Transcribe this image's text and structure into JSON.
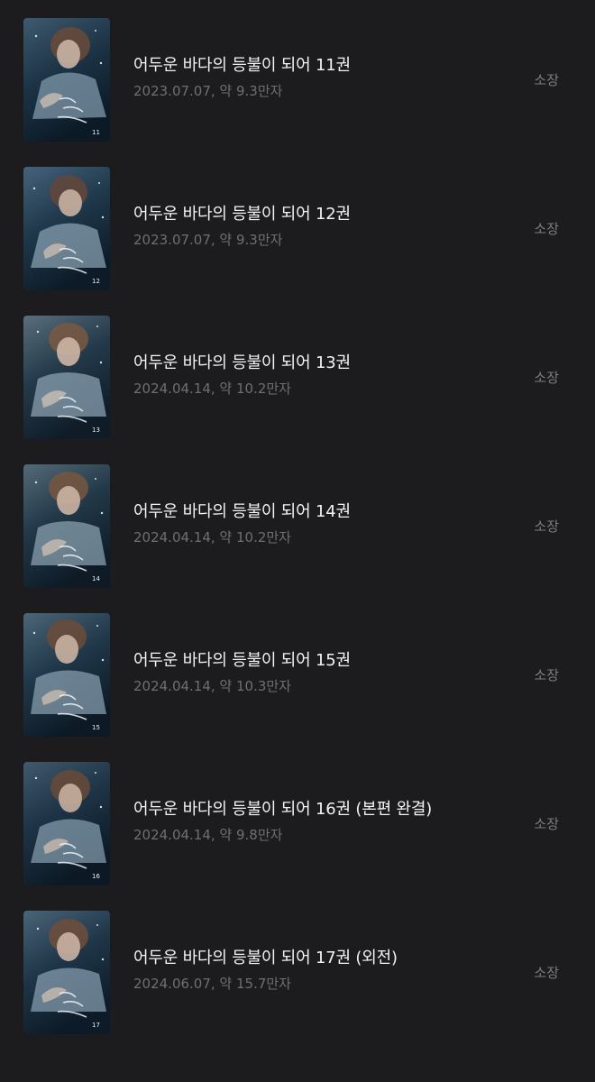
{
  "books": [
    {
      "title": "어두운 바다의 등불이 되어 11권",
      "meta": "2023.07.07, 약 9.3만자",
      "status": "소장",
      "cover_number": "11"
    },
    {
      "title": "어두운 바다의 등불이 되어 12권",
      "meta": "2023.07.07, 약 9.3만자",
      "status": "소장",
      "cover_number": "12"
    },
    {
      "title": "어두운 바다의 등불이 되어 13권",
      "meta": "2024.04.14, 약 10.2만자",
      "status": "소장",
      "cover_number": "13"
    },
    {
      "title": "어두운 바다의 등불이 되어 14권",
      "meta": "2024.04.14, 약 10.2만자",
      "status": "소장",
      "cover_number": "14"
    },
    {
      "title": "어두운 바다의 등불이 되어 15권",
      "meta": "2024.04.14, 약 10.3만자",
      "status": "소장",
      "cover_number": "15"
    },
    {
      "title": "어두운 바다의 등불이 되어 16권 (본편 완결)",
      "meta": "2024.04.14, 약 9.8만자",
      "status": "소장",
      "cover_number": "16"
    },
    {
      "title": "어두운 바다의 등불이 되어 17권 (외전)",
      "meta": "2024.06.07, 약 15.7만자",
      "status": "소장",
      "cover_number": "17"
    }
  ],
  "colors": {
    "background": "#1c1c1e",
    "title": "#f2f2f2",
    "meta": "#6f6f73",
    "status": "#7d7d82",
    "cover_dark": "#0f2230",
    "cover_light": "#5f7f96"
  }
}
